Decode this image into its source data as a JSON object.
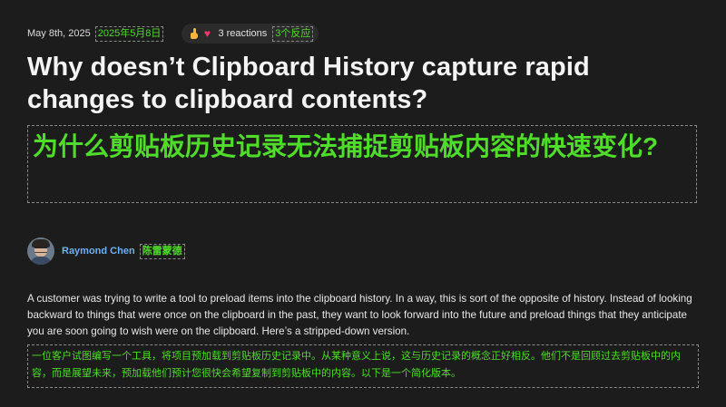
{
  "meta": {
    "date": "May 8th, 2025",
    "date_translation": "2025年5月8日",
    "reactions": {
      "emoji_icons": [
        "thumbs-up-icon",
        "heart-icon"
      ],
      "count_label": "3 reactions",
      "count_translation": "3个反应"
    }
  },
  "article": {
    "title": "Why doesn’t Clipboard History capture rapid changes to clipboard contents?",
    "title_translation": "为什么剪贴板历史记录无法捕捉剪贴板内容的快速变化?",
    "author": {
      "name": "Raymond Chen",
      "name_translation": "陈雷蒙德"
    },
    "paragraph": "A customer was trying to write a tool to preload items into the clipboard history. In a way, this is sort of the opposite of history. Instead of looking backward to things that were once on the clipboard in the past, they want to look forward into the future and preload things that they anticipate you are soon going to wish were on the clipboard. Here’s a stripped-down version.",
    "paragraph_translation": "一位客户试图编写一个工具，将项目预加载到剪贴板历史记录中。从某种意义上说，这与历史记录的概念正好相反。他们不是回顾过去剪贴板中的内容，而是展望未来，预加载他们预计您很快会希望复制到剪贴板中的内容。以下是一个简化版本。"
  },
  "colors": {
    "background": "#1c1c1c",
    "translation_text": "#4fdc2a",
    "author_link": "#6fb0f2"
  }
}
